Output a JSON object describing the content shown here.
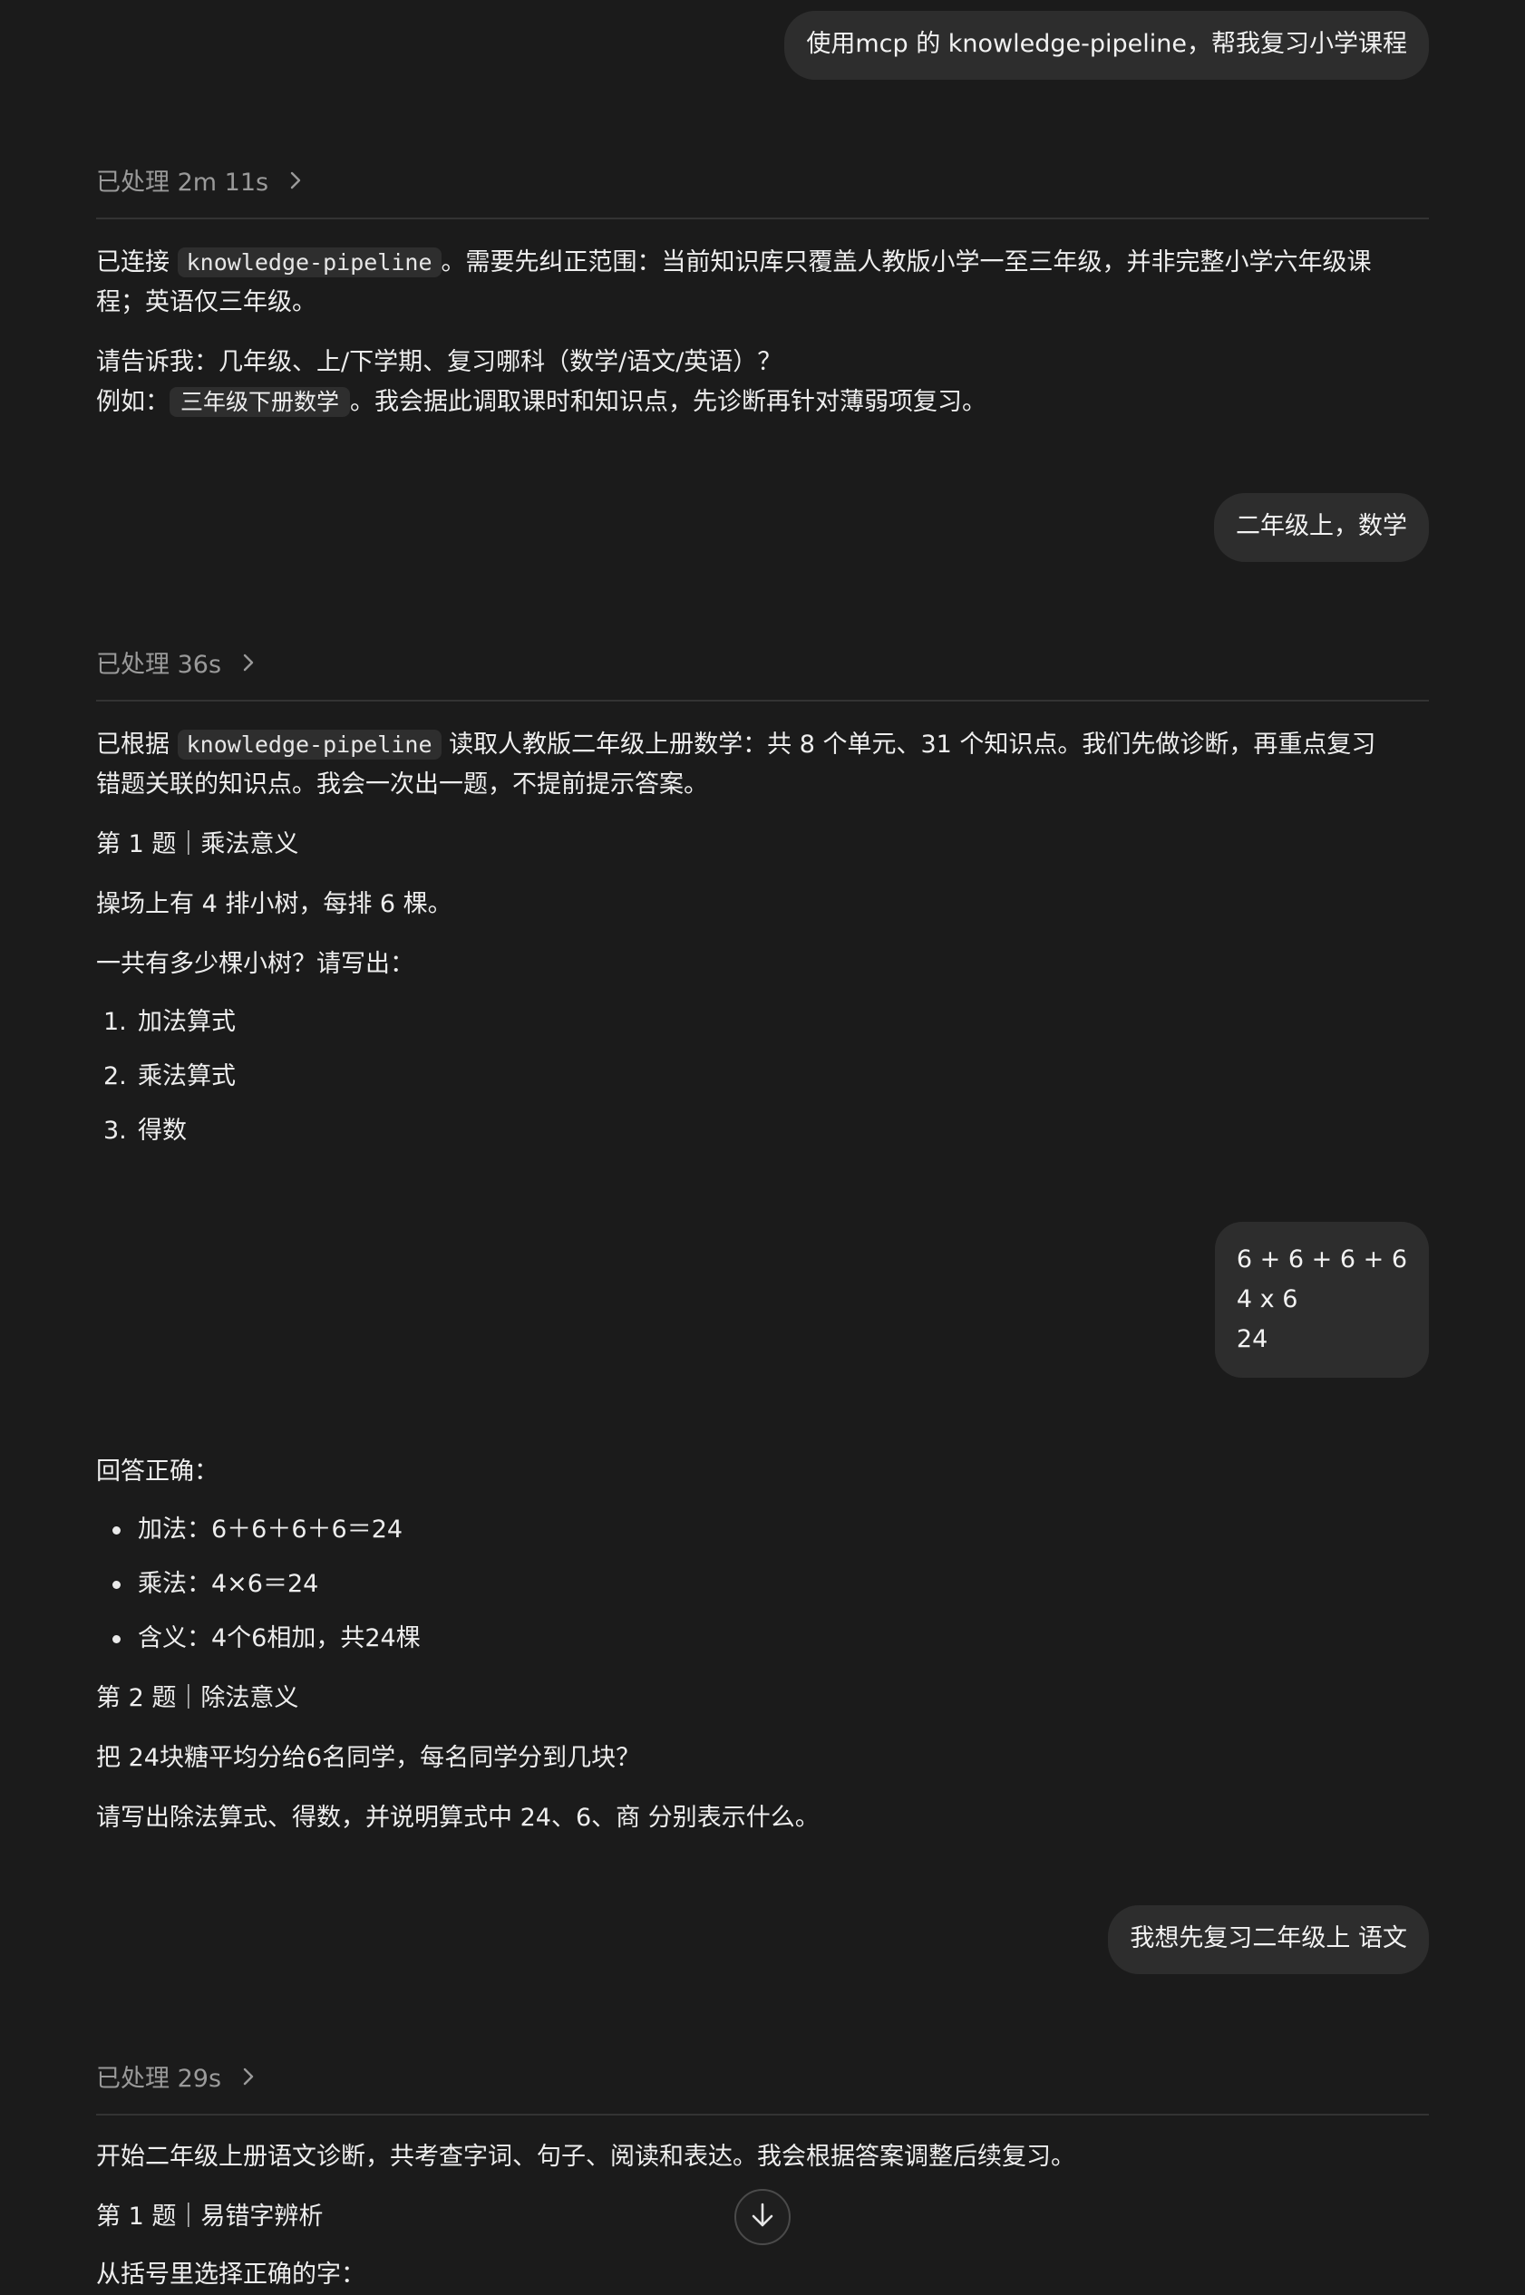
{
  "messages": {
    "user1": "使用mcp 的 knowledge-pipeline，帮我复习小学课程",
    "proc1": "已处理 2m 11s",
    "a1": {
      "p1_pre": "已连接 ",
      "p1_code": "knowledge-pipeline",
      "p1_post_line1": "。需要先纠正范围：当前知识库只覆盖人教版小学一至三年级，并非完整小学六年级课",
      "p1_line2": "程；英语仅三年级。",
      "p2_line1": "请告诉我：几年级、上/下学期、复习哪科（数学/语文/英语）？",
      "p2_pre": "例如：",
      "p2_chip": "三年级下册数学",
      "p2_post": "。我会据此调取课时和知识点，先诊断再针对薄弱项复习。"
    },
    "user2": "二年级上，数学",
    "proc2": "已处理 36s",
    "a2": {
      "p1_pre": "已根据 ",
      "p1_code": "knowledge-pipeline",
      "p1_post_line1": " 读取人教版二年级上册数学：共 8 个单元、31 个知识点。我们先做诊断，再重点复习",
      "p1_line2": "错题关联的知识点。我会一次出一题，不提前提示答案。",
      "q1_title": "第 1 题｜乘法意义",
      "q1_text": "操场上有 4 排小树，每排 6 棵。",
      "q1_ask": "一共有多少棵小树？请写出：",
      "q1_items": [
        "加法算式",
        "乘法算式",
        "得数"
      ]
    },
    "user3": {
      "line1": "6 + 6 + 6 + 6",
      "line2": "4 x 6",
      "line3": "24"
    },
    "a3": {
      "result": "回答正确：",
      "bullets": [
        "加法：6＋6＋6＋6＝24",
        "乘法：4×6＝24",
        "含义：4个6相加，共24棵"
      ],
      "q2_title": "第 2 题｜除法意义",
      "q2_text": "把 24块糖平均分给6名同学，每名同学分到几块？",
      "q2_ask": "请写出除法算式、得数，并说明算式中 24、6、商 分别表示什么。"
    },
    "user4": "我想先复习二年级上 语文",
    "proc3": "已处理 29s",
    "a4": {
      "intro": "开始二年级上册语文诊断，共考查字词、句子、阅读和表达。我会根据答案调整后续复习。",
      "q1_title": "第 1 题｜易错字辨析",
      "q1_cut": "从括号里选择正确的字："
    }
  },
  "icons": {
    "chevron": "chevron-right-icon",
    "scroll": "arrow-down-icon"
  }
}
